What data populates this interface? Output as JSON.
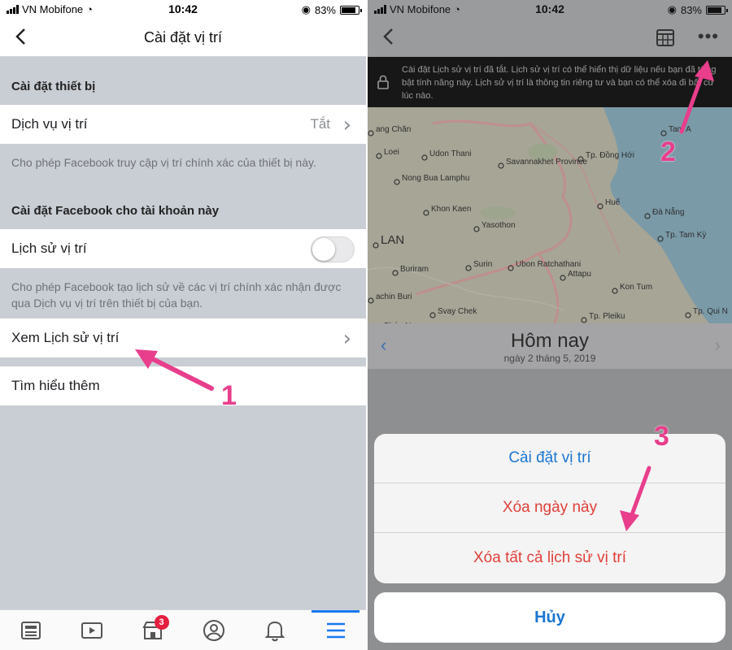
{
  "status": {
    "carrier": "VN Mobifone",
    "time": "10:42",
    "battery": "83%"
  },
  "left": {
    "nav_title": "Cài đặt vị trí",
    "section_device": "Cài đặt thiết bị",
    "location_services_label": "Dịch vụ vị trí",
    "location_services_value": "Tắt",
    "location_services_desc": "Cho phép Facebook truy cập vị trí chính xác của thiết bị này.",
    "section_facebook": "Cài đặt Facebook cho tài khoản này",
    "location_history_label": "Lịch sử vị trí",
    "location_history_desc": "Cho phép Facebook tạo lịch sử về các vị trí chính xác nhận được qua Dịch vụ vị trí trên thiết bị của bạn.",
    "view_history_label": "Xem Lịch sử vị trí",
    "learn_more_label": "Tìm hiểu thêm",
    "step_number": "1",
    "tabbar": {
      "items": [
        "news-feed-icon",
        "watch-icon",
        "marketplace-icon",
        "profile-icon",
        "notifications-icon",
        "menu-icon"
      ],
      "marketplace_badge": "3",
      "active_index": 5
    }
  },
  "right": {
    "banner_text": "Cài đặt Lịch sử vị trí đã tắt. Lịch sử vị trí có thể hiển thị dữ liệu nếu bạn đã từng bật tính năng này. Lịch sử vị trí là thông tin riêng tư và bạn có thể xóa đi bất cứ lúc nào.",
    "map_labels": [
      "ang Chăn",
      "Loei",
      "Udon Thani",
      "Nong Bua Lamphu",
      "Savannakhet Province",
      "Tp. Đồng Hới",
      "Khon Kaen",
      "Huế",
      "Đà Nẵng",
      "Yasothon",
      "Tp. Tam Kỳ",
      "LAN",
      "Buriram",
      "Surin",
      "Ubon Ratchathani",
      "Attapu",
      "Kon Tum",
      "achin Buri",
      "Svay Chek",
      "Tp. Pleiku",
      "Tp. Qui N",
      "Tam A",
      "Pháp N"
    ],
    "date_title": "Hôm nay",
    "date_sub": "ngày 2 tháng 5, 2019",
    "sheet_options": [
      "Cài đặt vị trí",
      "Xóa ngày này",
      "Xóa tất cả lịch sử vị trí"
    ],
    "cancel_label": "Hủy",
    "step2": "2",
    "step3": "3"
  },
  "colors": {
    "link_blue": "#1b76d2",
    "destructive_red": "#e0403a",
    "annotation_pink": "#e83e8c",
    "facebook_blue": "#1877f2"
  }
}
